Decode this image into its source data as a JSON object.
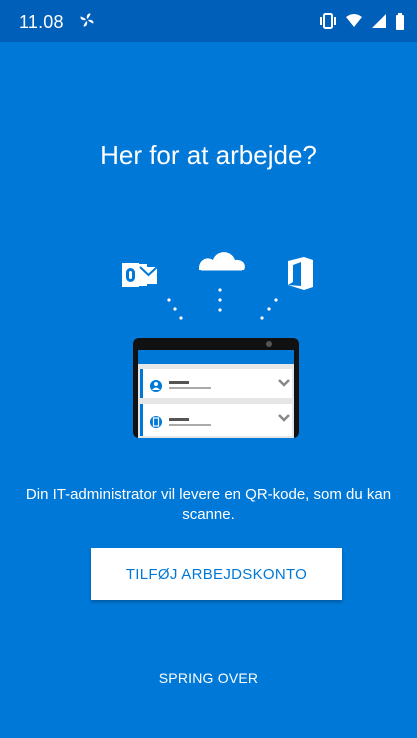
{
  "status_bar": {
    "time": "11.08",
    "icons": [
      "fan-icon",
      "vibrate-icon",
      "wifi-icon",
      "signal-icon",
      "battery-icon"
    ]
  },
  "onboarding": {
    "title": "Her for at arbejde?",
    "description": "Din IT-administrator vil levere en QR-kode, som du kan scanne.",
    "primary_button": "TILFØJ ARBEJDSKONTO",
    "skip_button": "SPRING OVER"
  },
  "illustration": {
    "app_icons": [
      "outlook-icon",
      "onedrive-icon",
      "office-icon"
    ],
    "device_list_items": [
      "account-item",
      "account-item"
    ]
  },
  "colors": {
    "background": "#0078d7",
    "status_bar": "#005fb8",
    "button_bg": "#ffffff",
    "button_text": "#0078d7"
  }
}
